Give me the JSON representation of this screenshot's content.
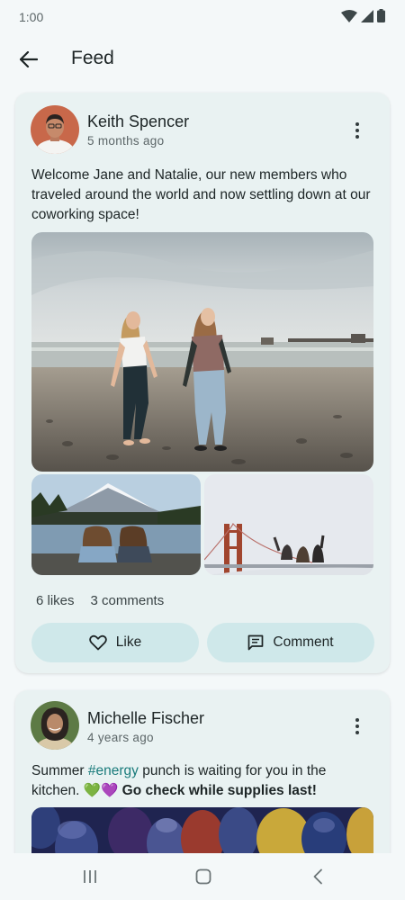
{
  "status_bar": {
    "time": "1:00",
    "icons": [
      "wifi-icon",
      "signal-icon",
      "battery-icon"
    ]
  },
  "app_bar": {
    "back_icon": "arrow-back-icon",
    "title": "Feed"
  },
  "posts": [
    {
      "author": "Keith Spencer",
      "time": "5 months ago",
      "text": "Welcome Jane and Natalie, our new members who traveled around the world and now settling down at our coworking space!",
      "images": [
        "beach-photo",
        "mountain-lake-photo",
        "golden-gate-photo"
      ],
      "likes_label": "6 likes",
      "comments_label": "3 comments",
      "like_button": "Like",
      "comment_button": "Comment"
    },
    {
      "author": "Michelle Fischer",
      "time": "4 years ago",
      "text_before": "Summer ",
      "hashtag": "#energy",
      "text_mid": " punch is waiting for you in the kitchen. ",
      "emoji": "💚💜",
      "text_bold": " Go check while supplies last!",
      "images": [
        "figs-photo"
      ]
    }
  ],
  "colors": {
    "accent": "#1a7b7b",
    "card": "#e9f2f2",
    "button": "#cfe8ea",
    "background": "#f4f8f9"
  },
  "nav_bar": [
    "recents-icon",
    "home-icon",
    "back-icon"
  ]
}
